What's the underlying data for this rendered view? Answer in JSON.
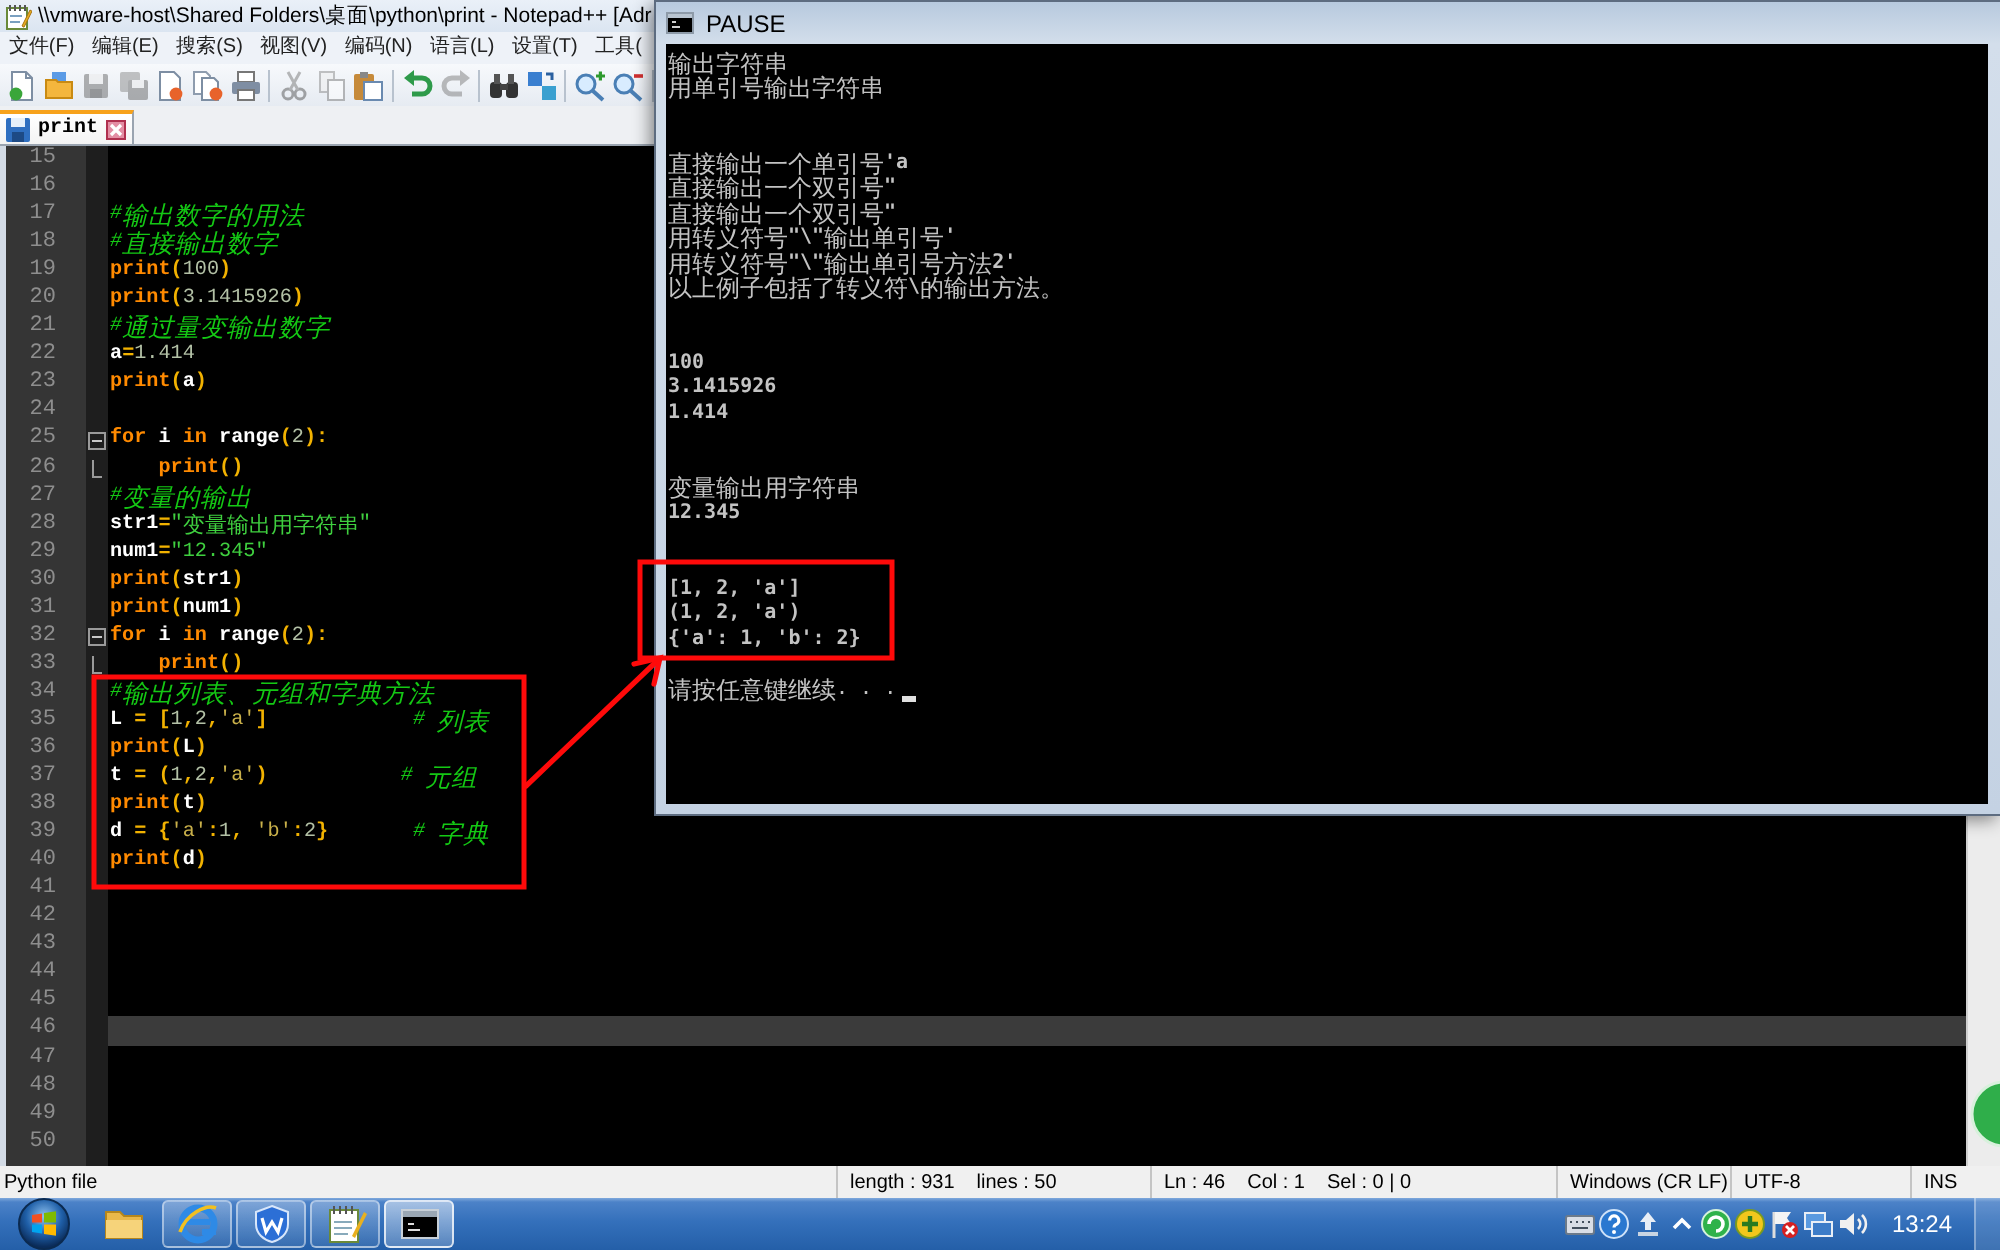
{
  "notepad": {
    "title": "\\\\vmware-host\\Shared Folders\\桌面\\python\\print - Notepad++ [Adr",
    "menu": [
      "文件(F)",
      "编辑(E)",
      "搜索(S)",
      "视图(V)",
      "编码(N)",
      "语言(L)",
      "设置(T)",
      "工具("
    ],
    "toolbar": [
      [
        {
          "kind": "new",
          "disabled": false
        },
        {
          "kind": "open",
          "disabled": false
        },
        {
          "kind": "save",
          "disabled": true
        },
        {
          "kind": "save_all",
          "disabled": true
        },
        {
          "kind": "close",
          "disabled": false
        },
        {
          "kind": "close_all",
          "disabled": false
        },
        {
          "kind": "print",
          "disabled": false
        }
      ],
      [
        {
          "kind": "cut",
          "disabled": true
        },
        {
          "kind": "copy",
          "disabled": true
        },
        {
          "kind": "paste",
          "disabled": false
        }
      ],
      [
        {
          "kind": "undo",
          "disabled": false
        },
        {
          "kind": "redo",
          "disabled": true
        }
      ],
      [
        {
          "kind": "find",
          "disabled": false
        },
        {
          "kind": "replace",
          "disabled": false
        }
      ],
      [
        {
          "kind": "zoom_in",
          "disabled": false
        },
        {
          "kind": "zoom_out",
          "disabled": false
        }
      ]
    ],
    "tabs": [
      {
        "label": "print",
        "selected": true,
        "modified": false
      }
    ],
    "editor": {
      "lines": [
        {
          "number": "15",
          "kind": "plain",
          "current": false
        },
        {
          "number": "16",
          "kind": "plain",
          "current": false
        },
        {
          "number": "17",
          "kind": "plain",
          "current": false,
          "tokens": [
            {
              "kind": "comment",
              "text": "#输出数字的用法"
            }
          ]
        },
        {
          "number": "18",
          "kind": "plain",
          "current": false,
          "tokens": [
            {
              "kind": "comment",
              "text": "#直接输出数字"
            }
          ]
        },
        {
          "number": "19",
          "kind": "plain",
          "current": false,
          "tokens": [
            {
              "kind": "keyword",
              "text": "print"
            },
            {
              "kind": "op",
              "text": "("
            },
            {
              "kind": "number",
              "text": "100"
            },
            {
              "kind": "op",
              "text": ")"
            }
          ]
        },
        {
          "number": "20",
          "kind": "plain",
          "current": false,
          "tokens": [
            {
              "kind": "keyword",
              "text": "print"
            },
            {
              "kind": "op",
              "text": "("
            },
            {
              "kind": "number",
              "text": "3.1415926"
            },
            {
              "kind": "op",
              "text": ")"
            }
          ]
        },
        {
          "number": "21",
          "kind": "plain",
          "current": false,
          "tokens": [
            {
              "kind": "comment",
              "text": "#通过量变输出数字"
            }
          ]
        },
        {
          "number": "22",
          "kind": "plain",
          "current": false,
          "tokens": [
            {
              "kind": "name",
              "text": "a"
            },
            {
              "kind": "op",
              "text": "="
            },
            {
              "kind": "number",
              "text": "1.414"
            }
          ]
        },
        {
          "number": "23",
          "kind": "plain",
          "current": false,
          "tokens": [
            {
              "kind": "keyword",
              "text": "print"
            },
            {
              "kind": "op",
              "text": "("
            },
            {
              "kind": "name",
              "text": "a"
            },
            {
              "kind": "op",
              "text": ")"
            }
          ]
        },
        {
          "number": "24",
          "kind": "plain",
          "current": false
        },
        {
          "number": "25",
          "kind": "fold_start",
          "current": false,
          "tokens": [
            {
              "kind": "keyword",
              "text": "for"
            },
            {
              "kind": "name",
              "text": " i "
            },
            {
              "kind": "keyword",
              "text": "in"
            },
            {
              "kind": "name",
              "text": " range"
            },
            {
              "kind": "op",
              "text": "("
            },
            {
              "kind": "number",
              "text": "2"
            },
            {
              "kind": "op",
              "text": "):"
            }
          ]
        },
        {
          "number": "26",
          "kind": "fold_end",
          "current": false,
          "tokens": [
            {
              "kind": "keyword",
              "text": "    print"
            },
            {
              "kind": "op",
              "text": "()"
            }
          ]
        },
        {
          "number": "27",
          "kind": "plain",
          "current": false,
          "tokens": [
            {
              "kind": "comment",
              "text": "#变量的输出"
            }
          ]
        },
        {
          "number": "28",
          "kind": "plain",
          "current": false,
          "tokens": [
            {
              "kind": "name",
              "text": "str1"
            },
            {
              "kind": "op",
              "text": "="
            },
            {
              "kind": "string",
              "text": "\"变量输出用字符串\""
            }
          ]
        },
        {
          "number": "29",
          "kind": "plain",
          "current": false,
          "tokens": [
            {
              "kind": "name",
              "text": "num1"
            },
            {
              "kind": "op",
              "text": "="
            },
            {
              "kind": "string",
              "text": "\"12.345\""
            }
          ]
        },
        {
          "number": "30",
          "kind": "plain",
          "current": false,
          "tokens": [
            {
              "kind": "keyword",
              "text": "print"
            },
            {
              "kind": "op",
              "text": "("
            },
            {
              "kind": "name",
              "text": "str1"
            },
            {
              "kind": "op",
              "text": ")"
            }
          ]
        },
        {
          "number": "31",
          "kind": "plain",
          "current": false,
          "tokens": [
            {
              "kind": "keyword",
              "text": "print"
            },
            {
              "kind": "op",
              "text": "("
            },
            {
              "kind": "name",
              "text": "num1"
            },
            {
              "kind": "op",
              "text": ")"
            }
          ]
        },
        {
          "number": "32",
          "kind": "fold_start",
          "current": false,
          "tokens": [
            {
              "kind": "keyword",
              "text": "for"
            },
            {
              "kind": "name",
              "text": " i "
            },
            {
              "kind": "keyword",
              "text": "in"
            },
            {
              "kind": "name",
              "text": " range"
            },
            {
              "kind": "op",
              "text": "("
            },
            {
              "kind": "number",
              "text": "2"
            },
            {
              "kind": "op",
              "text": "):"
            }
          ]
        },
        {
          "number": "33",
          "kind": "fold_end",
          "current": false,
          "tokens": [
            {
              "kind": "keyword",
              "text": "    print"
            },
            {
              "kind": "op",
              "text": "()"
            }
          ]
        },
        {
          "number": "34",
          "kind": "plain",
          "current": false,
          "tokens": [
            {
              "kind": "comment",
              "text": "#输出列表、元组和字典方法"
            }
          ]
        },
        {
          "number": "35",
          "kind": "plain",
          "current": false,
          "tokens": [
            {
              "kind": "name",
              "text": "L "
            },
            {
              "kind": "op",
              "text": "= ["
            },
            {
              "kind": "number",
              "text": "1"
            },
            {
              "kind": "op",
              "text": ","
            },
            {
              "kind": "number",
              "text": "2"
            },
            {
              "kind": "op",
              "text": ","
            },
            {
              "kind": "char",
              "text": "'a'"
            },
            {
              "kind": "op",
              "text": "]"
            },
            {
              "kind": "comment",
              "text": "            # 列表"
            }
          ]
        },
        {
          "number": "36",
          "kind": "plain",
          "current": false,
          "tokens": [
            {
              "kind": "keyword",
              "text": "print"
            },
            {
              "kind": "op",
              "text": "("
            },
            {
              "kind": "name",
              "text": "L"
            },
            {
              "kind": "op",
              "text": ")"
            }
          ]
        },
        {
          "number": "37",
          "kind": "plain",
          "current": false,
          "tokens": [
            {
              "kind": "name",
              "text": "t "
            },
            {
              "kind": "op",
              "text": "= ("
            },
            {
              "kind": "number",
              "text": "1"
            },
            {
              "kind": "op",
              "text": ","
            },
            {
              "kind": "number",
              "text": "2"
            },
            {
              "kind": "op",
              "text": ","
            },
            {
              "kind": "char",
              "text": "'a'"
            },
            {
              "kind": "op",
              "text": ")"
            },
            {
              "kind": "comment",
              "text": "           # 元组"
            }
          ]
        },
        {
          "number": "38",
          "kind": "plain",
          "current": false,
          "tokens": [
            {
              "kind": "keyword",
              "text": "print"
            },
            {
              "kind": "op",
              "text": "("
            },
            {
              "kind": "name",
              "text": "t"
            },
            {
              "kind": "op",
              "text": ")"
            }
          ]
        },
        {
          "number": "39",
          "kind": "plain",
          "current": false,
          "tokens": [
            {
              "kind": "name",
              "text": "d "
            },
            {
              "kind": "op",
              "text": "= {"
            },
            {
              "kind": "char",
              "text": "'a'"
            },
            {
              "kind": "op",
              "text": ":"
            },
            {
              "kind": "number",
              "text": "1"
            },
            {
              "kind": "op",
              "text": ", "
            },
            {
              "kind": "char",
              "text": "'b'"
            },
            {
              "kind": "op",
              "text": ":"
            },
            {
              "kind": "number",
              "text": "2"
            },
            {
              "kind": "op",
              "text": "}"
            },
            {
              "kind": "comment",
              "text": "       # 字典"
            }
          ]
        },
        {
          "number": "40",
          "kind": "plain",
          "current": false,
          "tokens": [
            {
              "kind": "keyword",
              "text": "print"
            },
            {
              "kind": "op",
              "text": "("
            },
            {
              "kind": "name",
              "text": "d"
            },
            {
              "kind": "op",
              "text": ")"
            }
          ]
        },
        {
          "number": "41",
          "kind": "plain",
          "current": false
        },
        {
          "number": "42",
          "kind": "plain",
          "current": false
        },
        {
          "number": "43",
          "kind": "plain",
          "current": false
        },
        {
          "number": "44",
          "kind": "plain",
          "current": false
        },
        {
          "number": "45",
          "kind": "plain",
          "current": false
        },
        {
          "number": "46",
          "kind": "plain",
          "current": true
        },
        {
          "number": "47",
          "kind": "plain",
          "current": false
        },
        {
          "number": "48",
          "kind": "plain",
          "current": false
        },
        {
          "number": "49",
          "kind": "plain",
          "current": false
        },
        {
          "number": "50",
          "kind": "plain",
          "current": false
        }
      ]
    },
    "status_bar": {
      "file_type": "Python file",
      "length": "length : 931",
      "lines": "lines : 50",
      "line": "Ln : 46",
      "column": "Col : 1",
      "selection": "Sel : 0 | 0",
      "line_ending": "Windows (CR LF)",
      "encoding": "UTF-8",
      "mode": "INS"
    }
  },
  "console": {
    "title": "PAUSE",
    "blocks": [
      [
        "输出字符串",
        "用单引号输出字符串"
      ],
      [
        "直接输出一个单引号'a",
        "直接输出一个双引号\"",
        "直接输出一个双引号\"",
        "用转义符号\"\\\"输出单引号'",
        "用转义符号\"\\\"输出单引号方法2'",
        "以上例子包括了转义符\\的输出方法。"
      ],
      [
        "100",
        "3.1415926",
        "1.414"
      ],
      [
        "变量输出用字符串",
        "12.345"
      ],
      [
        "[1, 2, 'a']",
        "(1, 2, 'a')",
        "{'a': 1, 'b': 2}"
      ]
    ],
    "prompt": "请按任意键继续. . ."
  },
  "taskbar": {
    "apps": [
      {
        "kind": "folder",
        "running": false,
        "active": false
      },
      {
        "kind": "browser",
        "running": true,
        "active": false
      },
      {
        "kind": "shield",
        "running": true,
        "active": false
      },
      {
        "kind": "notepad",
        "running": true,
        "active": false
      },
      {
        "kind": "console",
        "running": true,
        "active": true
      }
    ],
    "clock": "13:24"
  }
}
